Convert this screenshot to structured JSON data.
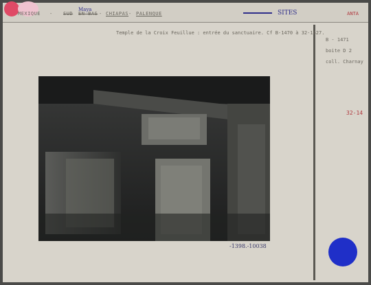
{
  "header": {
    "country": "MEXIQUE",
    "region_struck": "SUD",
    "region_struck_2": "EN BAS",
    "handwritten_region": "Maya",
    "state": "CHIAPAS",
    "site": "PALENQUE",
    "handwritten_category": "SITES",
    "code": "ANTA"
  },
  "caption": "Temple de la Croix Feuillue : entrée du sanctuaire. Cf B-1470 à 32-1627.",
  "side": {
    "line1": "B - 1471",
    "line2": "boite D 2",
    "line3": "coll. Charnay",
    "handwritten_number": "32-14"
  },
  "photo_number": "-1398.-10038",
  "colors": {
    "card": "#d8d4cb",
    "blue_dot": "#1f2fc8",
    "red_sticker": "#e04a66",
    "pink_sticker": "#efc3cf",
    "ink_blue": "#2f2e8a"
  }
}
